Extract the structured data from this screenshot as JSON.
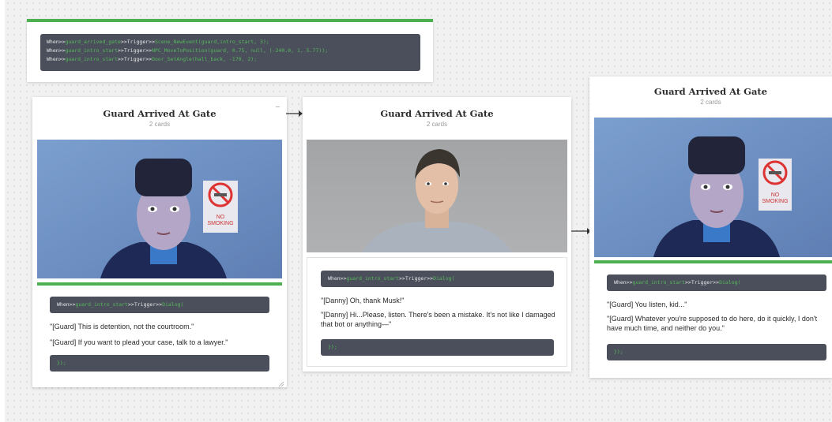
{
  "top_code": {
    "lines": [
      {
        "kw": "When>>",
        "event": "guard_arrived_gate",
        "mid": ">>Trigger>>",
        "action": "Scene_NewEvent(guard,intro_start, 3);"
      },
      {
        "kw": "When>>",
        "event": "guard_intro_start",
        "mid": ">>Trigger>>",
        "action": "NPC_MoveToPosition(guard, 0.75, null, (-240.0, 1, 5.77));"
      },
      {
        "kw": "When>>",
        "event": "guard_intro_start",
        "mid": ">>Trigger>>",
        "action": "Door_SetAngle(hall_back, -170, 2);"
      }
    ]
  },
  "cards": [
    {
      "title": "Guard Arrived At Gate",
      "subtitle": "2 cards",
      "code": {
        "kw": "When>>",
        "event": "guard_intro_start",
        "mid": ">>Trigger>>",
        "action": "Dialog("
      },
      "code_end": "});",
      "lines": [
        "\"[Guard] This is detention, not the courtroom.\"",
        "\"[Guard] If you want to plead your case, talk to a lawyer.\""
      ],
      "sign": {
        "line1": "NO",
        "line2": "SMOKING"
      }
    },
    {
      "title": "Guard Arrived At Gate",
      "subtitle": "2 cards",
      "code": {
        "kw": "When>>",
        "event": "guard_intro_start",
        "mid": ">>Trigger>>",
        "action": "Dialog("
      },
      "code_end": "});",
      "lines": [
        "\"[Danny] Oh, thank Musk!\"",
        "\"[Danny] Hi...Please, listen. There's been a mistake. It's not like I damaged that bot or anything—\""
      ]
    },
    {
      "title": "Guard Arrived At Gate",
      "subtitle": "2 cards",
      "code": {
        "kw": "When>>",
        "event": "guard_intro_start",
        "mid": ">>Trigger>>",
        "action": "Dialog("
      },
      "code_end": "});",
      "lines": [
        "\"[Guard] You listen, kid...\"",
        "\"[Guard] Whatever you're supposed to do here, do it quickly, I don't have much time, and neither do you.\""
      ],
      "sign": {
        "line1": "NO",
        "line2": "SMOKING"
      }
    }
  ],
  "colors": {
    "accent_green": "#4caf50",
    "code_bg": "#4a4f5b",
    "code_keyword": "#56b85a"
  }
}
